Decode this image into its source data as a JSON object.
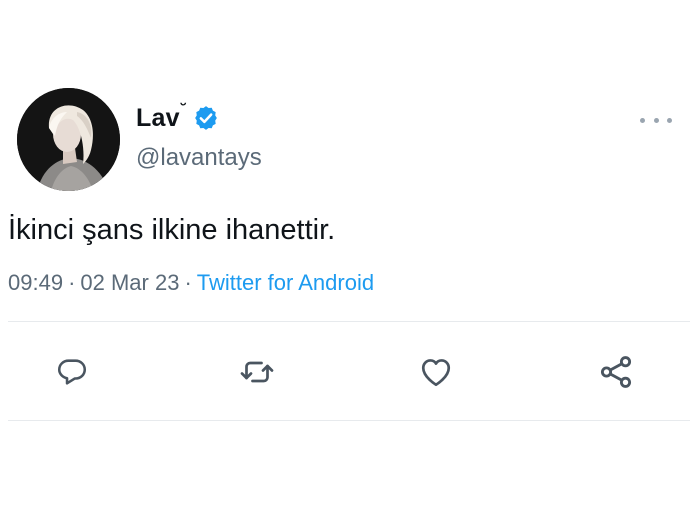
{
  "author": {
    "display_name": "Lav",
    "name_mark": "˘",
    "handle": "@lavantays",
    "verified": true,
    "verified_color": "#1d9bf0"
  },
  "tweet": {
    "text": "İkinci şans ilkine ihanettir.",
    "time": "09:49",
    "date": "02 Mar 23",
    "separator": "·",
    "source": "Twitter for Android"
  },
  "actions": [
    {
      "icon": "reply-icon"
    },
    {
      "icon": "retweet-icon"
    },
    {
      "icon": "like-icon"
    },
    {
      "icon": "share-icon"
    }
  ],
  "more_menu": {
    "icon": "more-options-icon"
  },
  "colors": {
    "text_primary": "#0f1419",
    "text_secondary": "#5b6a78",
    "link": "#1d9bf0",
    "divider": "#e7eaed",
    "icon": "#4a5560"
  }
}
